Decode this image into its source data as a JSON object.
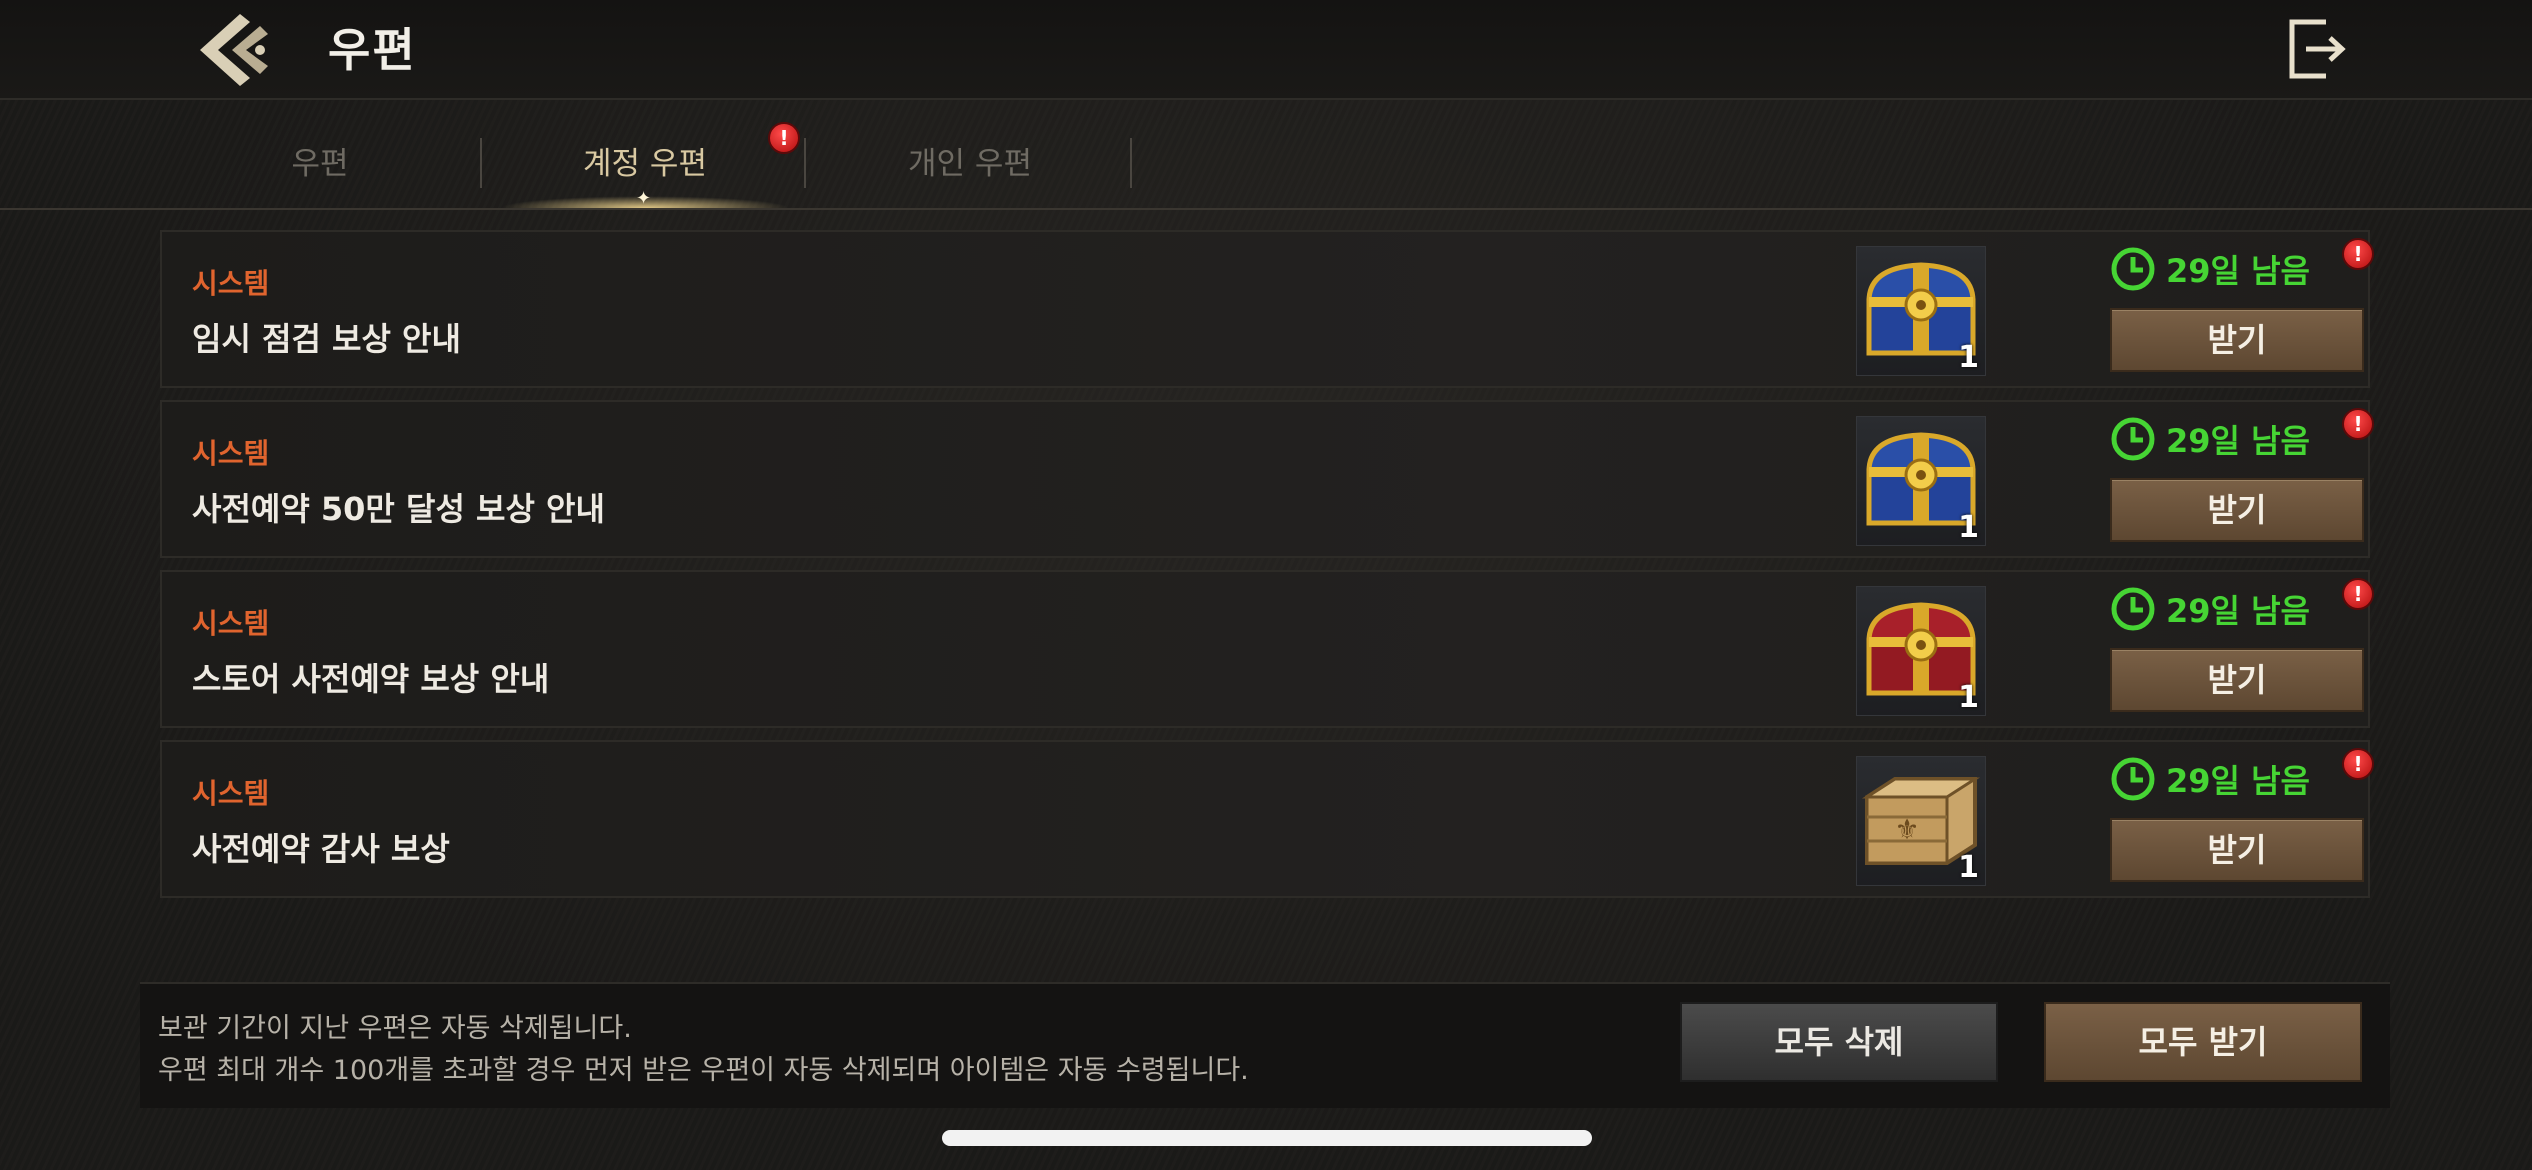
{
  "header": {
    "title": "우편",
    "back_icon": "double-chevron-left-icon",
    "exit_icon": "exit-door-icon"
  },
  "tabs": [
    {
      "label": "우편",
      "active": false,
      "badge": false
    },
    {
      "label": "계정 우편",
      "active": true,
      "badge": true
    },
    {
      "label": "개인 우편",
      "active": false,
      "badge": false
    }
  ],
  "badge_text": "!",
  "mails": [
    {
      "sender": "시스템",
      "subject": "임시 점검 보상 안내",
      "item": "blue-chest-icon",
      "item_count": "1",
      "time_left": "29일 남음",
      "claim_label": "받기"
    },
    {
      "sender": "시스템",
      "subject": "사전예약 50만 달성 보상 안내",
      "item": "blue-chest-icon",
      "item_count": "1",
      "time_left": "29일 남음",
      "claim_label": "받기"
    },
    {
      "sender": "시스템",
      "subject": "스토어 사전예약 보상 안내",
      "item": "red-chest-icon",
      "item_count": "1",
      "time_left": "29일 남음",
      "claim_label": "받기"
    },
    {
      "sender": "시스템",
      "subject": "사전예약 감사 보상",
      "item": "wooden-crate-icon",
      "item_count": "1",
      "time_left": "29일 남음",
      "claim_label": "받기"
    }
  ],
  "footer": {
    "notice_1": "보관 기간이 지난 우편은 자동 삭제됩니다.",
    "notice_2": "우편 최대 개수 100개를 초과할 경우 먼저 받은 우편이 자동 삭제되며 아이템은 자동 수령됩니다.",
    "delete_all_label": "모두 삭제",
    "claim_all_label": "모두 받기"
  },
  "colors": {
    "sender": "#e0642e",
    "timer": "#46d534",
    "claim_button": "#6b533b",
    "badge": "#d81e1e"
  }
}
